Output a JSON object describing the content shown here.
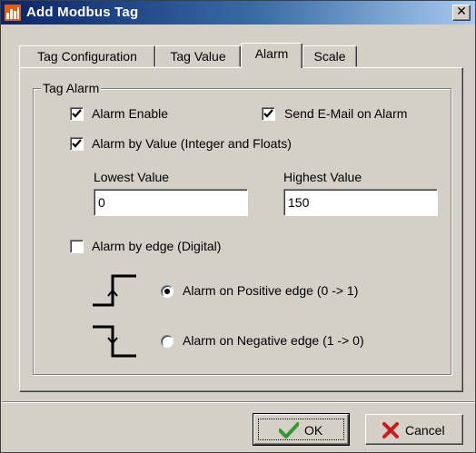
{
  "window": {
    "title": "Add Modbus Tag",
    "close_glyph": "✕"
  },
  "tabs": [
    {
      "label": "Tag Configuration",
      "active": false
    },
    {
      "label": "Tag Value",
      "active": false
    },
    {
      "label": "Alarm",
      "active": true
    },
    {
      "label": "Scale",
      "active": false
    }
  ],
  "group": {
    "legend": "Tag Alarm",
    "alarm_enable": {
      "label": "Alarm Enable",
      "checked": true
    },
    "send_email": {
      "label": "Send E-Mail on Alarm",
      "checked": true
    },
    "alarm_by_value": {
      "label": "Alarm by Value (Integer and Floats)",
      "checked": true
    },
    "lowest": {
      "label": "Lowest Value",
      "value": "0"
    },
    "highest": {
      "label": "Highest Value",
      "value": "150"
    },
    "alarm_by_edge": {
      "label": "Alarm by edge (Digital)",
      "checked": false
    },
    "positive_edge": {
      "label": "Alarm on Positive edge (0 -> 1)",
      "selected": true
    },
    "negative_edge": {
      "label": "Alarm on Negative edge (1 -> 0)",
      "selected": false
    }
  },
  "buttons": {
    "ok": {
      "label": "OK",
      "icon": "checkmark-icon"
    },
    "cancel": {
      "label": "Cancel",
      "icon": "cross-icon"
    }
  },
  "colors": {
    "title_start": "#0a246a",
    "title_end": "#a6caf0",
    "ok_check": "#2e9b2e",
    "cancel_x": "#cc1a1a"
  }
}
